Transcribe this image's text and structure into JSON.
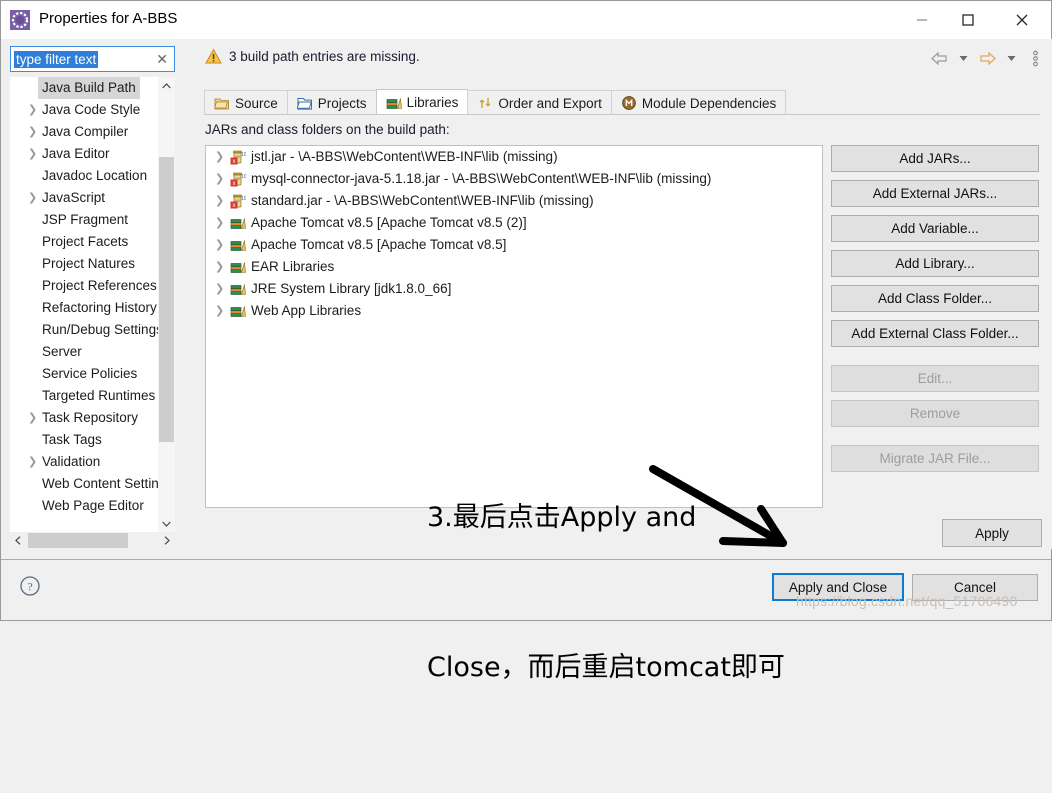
{
  "window": {
    "title": "Properties for A-BBS",
    "app_icon": "eclipse-gear-icon",
    "minimize": "−",
    "maximize": "□",
    "close": "✕"
  },
  "banner": {
    "icon": "warning-triangle-icon",
    "message": "3 build path entries are missing.",
    "nav": {
      "back": "back-arrow-icon",
      "back_menu": "chevron-down-icon",
      "forward": "forward-arrow-icon",
      "forward_menu": "chevron-down-icon",
      "overflow": "vertical-ellipsis-icon"
    }
  },
  "filter": {
    "value": "type filter text",
    "placeholder": "type filter text",
    "clear": "✕"
  },
  "sidebar": {
    "scroll_up": "▲",
    "scroll_down": "▼",
    "h_left": "❮",
    "h_right": "❯",
    "items": [
      {
        "label": "Java Build Path",
        "expandable": false,
        "selected": true
      },
      {
        "label": "Java Code Style",
        "expandable": true,
        "selected": false
      },
      {
        "label": "Java Compiler",
        "expandable": true,
        "selected": false
      },
      {
        "label": "Java Editor",
        "expandable": true,
        "selected": false
      },
      {
        "label": "Javadoc Location",
        "expandable": false,
        "selected": false
      },
      {
        "label": "JavaScript",
        "expandable": true,
        "selected": false
      },
      {
        "label": "JSP Fragment",
        "expandable": false,
        "selected": false
      },
      {
        "label": "Project Facets",
        "expandable": false,
        "selected": false
      },
      {
        "label": "Project Natures",
        "expandable": false,
        "selected": false
      },
      {
        "label": "Project References",
        "expandable": false,
        "selected": false
      },
      {
        "label": "Refactoring History",
        "expandable": false,
        "selected": false
      },
      {
        "label": "Run/Debug Settings",
        "expandable": false,
        "selected": false
      },
      {
        "label": "Server",
        "expandable": false,
        "selected": false
      },
      {
        "label": "Service Policies",
        "expandable": false,
        "selected": false
      },
      {
        "label": "Targeted Runtimes",
        "expandable": false,
        "selected": false
      },
      {
        "label": "Task Repository",
        "expandable": true,
        "selected": false
      },
      {
        "label": "Task Tags",
        "expandable": false,
        "selected": false
      },
      {
        "label": "Validation",
        "expandable": true,
        "selected": false
      },
      {
        "label": "Web Content Settings",
        "expandable": false,
        "selected": false
      },
      {
        "label": "Web Page Editor",
        "expandable": false,
        "selected": false
      }
    ]
  },
  "tabs": [
    {
      "label": "Source",
      "icon": "source-folder-icon",
      "active": false
    },
    {
      "label": "Projects",
      "icon": "open-folder-icon",
      "active": false
    },
    {
      "label": "Libraries",
      "icon": "library-books-icon",
      "active": true
    },
    {
      "label": "Order and Export",
      "icon": "order-export-icon",
      "active": false
    },
    {
      "label": "Module Dependencies",
      "icon": "module-circle-icon",
      "active": false
    }
  ],
  "main": {
    "section_label": "JARs and class folders on the build path:",
    "entries": [
      {
        "label": "jstl.jar - \\A-BBS\\WebContent\\WEB-INF\\lib (missing)",
        "icon": "jar-error-icon"
      },
      {
        "label": "mysql-connector-java-5.1.18.jar - \\A-BBS\\WebContent\\WEB-INF\\lib (missing)",
        "icon": "jar-error-icon"
      },
      {
        "label": "standard.jar - \\A-BBS\\WebContent\\WEB-INF\\lib (missing)",
        "icon": "jar-error-icon"
      },
      {
        "label": "Apache Tomcat v8.5 [Apache Tomcat v8.5 (2)]",
        "icon": "library-books-icon"
      },
      {
        "label": "Apache Tomcat v8.5 [Apache Tomcat v8.5]",
        "icon": "library-books-icon"
      },
      {
        "label": "EAR Libraries",
        "icon": "library-books-icon"
      },
      {
        "label": "JRE System Library [jdk1.8.0_66]",
        "icon": "library-books-icon"
      },
      {
        "label": "Web App Libraries",
        "icon": "library-books-icon"
      }
    ],
    "buttons": [
      {
        "label": "Add JARs...",
        "disabled": false,
        "gap": false
      },
      {
        "label": "Add External JARs...",
        "disabled": false,
        "gap": false
      },
      {
        "label": "Add Variable...",
        "disabled": false,
        "gap": false
      },
      {
        "label": "Add Library...",
        "disabled": false,
        "gap": false
      },
      {
        "label": "Add Class Folder...",
        "disabled": false,
        "gap": false
      },
      {
        "label": "Add External Class Folder...",
        "disabled": false,
        "gap": true
      },
      {
        "label": "Edit...",
        "disabled": true,
        "gap": false
      },
      {
        "label": "Remove",
        "disabled": true,
        "gap": true
      },
      {
        "label": "Migrate JAR File...",
        "disabled": true,
        "gap": false
      }
    ],
    "apply_label": "Apply"
  },
  "footer": {
    "help_icon": "question-mark-circle-icon",
    "apply_and_close": "Apply and Close",
    "cancel": "Cancel"
  },
  "annotation": {
    "line1": "3.最后点击Apply and",
    "line2": "Close，而后重启tomcat即可",
    "arrow": "annotation-arrow"
  },
  "watermark": "https://blog.csdn.net/qq_51706490",
  "colors": {
    "accent_blue": "#0a7bd4",
    "selection_blue": "#2f7fd8",
    "dialog_bg": "#f0f0f0",
    "button_bg": "#e1e1e1",
    "warning_yellow": "#f2b23c"
  }
}
